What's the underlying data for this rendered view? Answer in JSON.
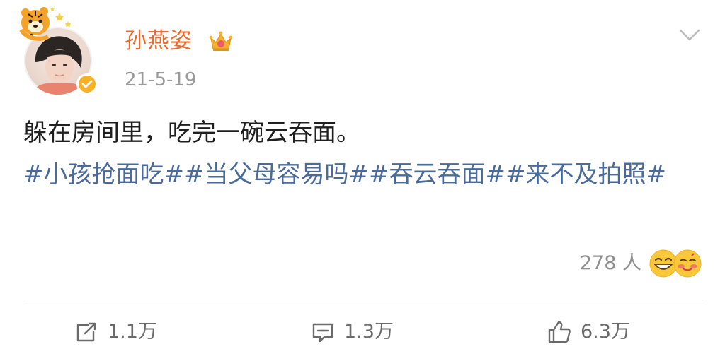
{
  "header": {
    "username": "孙燕姿",
    "timestamp": "21-5-19"
  },
  "body": {
    "text": "躲在房间里，吃完一碗云吞面。",
    "topics": [
      "#小孩抢面吃#",
      "#当父母容易吗#",
      "#吞云吞面#",
      "#来不及拍照#"
    ]
  },
  "reactions": {
    "count": "278 人"
  },
  "footer": {
    "repost_label": "1.1万",
    "comment_label": "1.3万",
    "like_label": "6.3万"
  },
  "colors": {
    "username": "#e86b2f",
    "topic": "#4a6a9a",
    "text": "#1f1f1f",
    "muted": "#9a9a9a"
  },
  "icons": [
    "tiger-deco",
    "crown-icon",
    "verified-badge-icon",
    "chevron-down-icon",
    "grin-emoji",
    "blush-emoji",
    "repost-icon",
    "comment-icon",
    "like-icon"
  ]
}
